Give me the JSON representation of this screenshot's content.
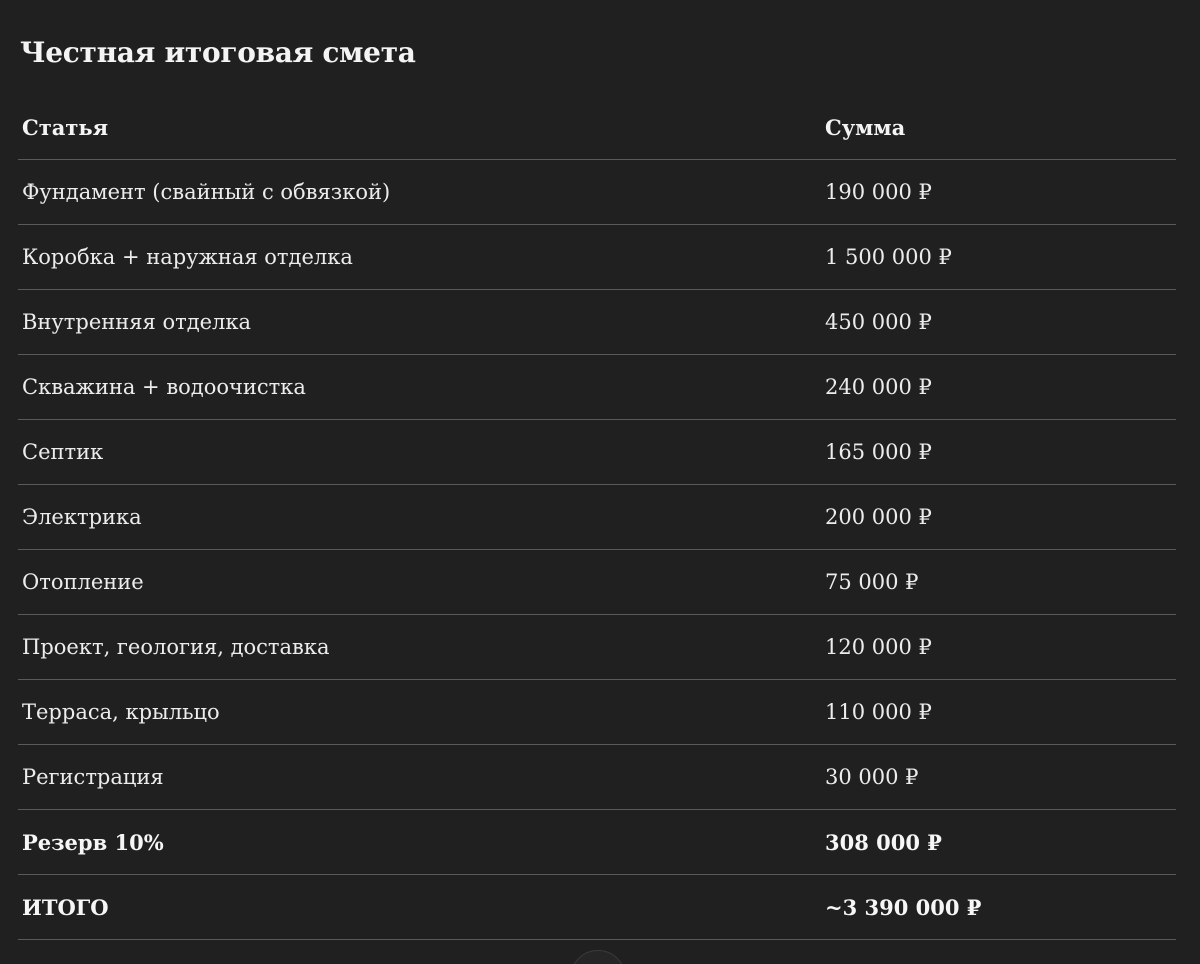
{
  "title": "Честная итоговая смета",
  "table": {
    "headers": {
      "item": "Статья",
      "amount": "Сумма"
    },
    "rows": [
      {
        "item": "Фундамент (свайный с обвязкой)",
        "amount": "190 000 ₽",
        "bold": false
      },
      {
        "item": "Коробка + наружная отделка",
        "amount": "1 500 000 ₽",
        "bold": false
      },
      {
        "item": "Внутренняя отделка",
        "amount": "450 000 ₽",
        "bold": false
      },
      {
        "item": "Скважина + водоочистка",
        "amount": "240 000 ₽",
        "bold": false
      },
      {
        "item": "Септик",
        "amount": "165 000 ₽",
        "bold": false
      },
      {
        "item": "Электрика",
        "amount": "200 000 ₽",
        "bold": false
      },
      {
        "item": "Отопление",
        "amount": "75 000 ₽",
        "bold": false
      },
      {
        "item": "Проект, геология, доставка",
        "amount": "120 000 ₽",
        "bold": false
      },
      {
        "item": "Терраса, крыльцо",
        "amount": "110 000 ₽",
        "bold": false
      },
      {
        "item": "Регистрация",
        "amount": "30 000 ₽",
        "bold": false
      },
      {
        "item": "Резерв 10%",
        "amount": "308 000 ₽",
        "bold": true
      },
      {
        "item": "ИТОГО",
        "amount": "~3 390 000 ₽",
        "bold": true
      }
    ]
  },
  "colors": {
    "background": "#202020",
    "text": "#f0f0f0",
    "divider": "#5a5a5a"
  }
}
